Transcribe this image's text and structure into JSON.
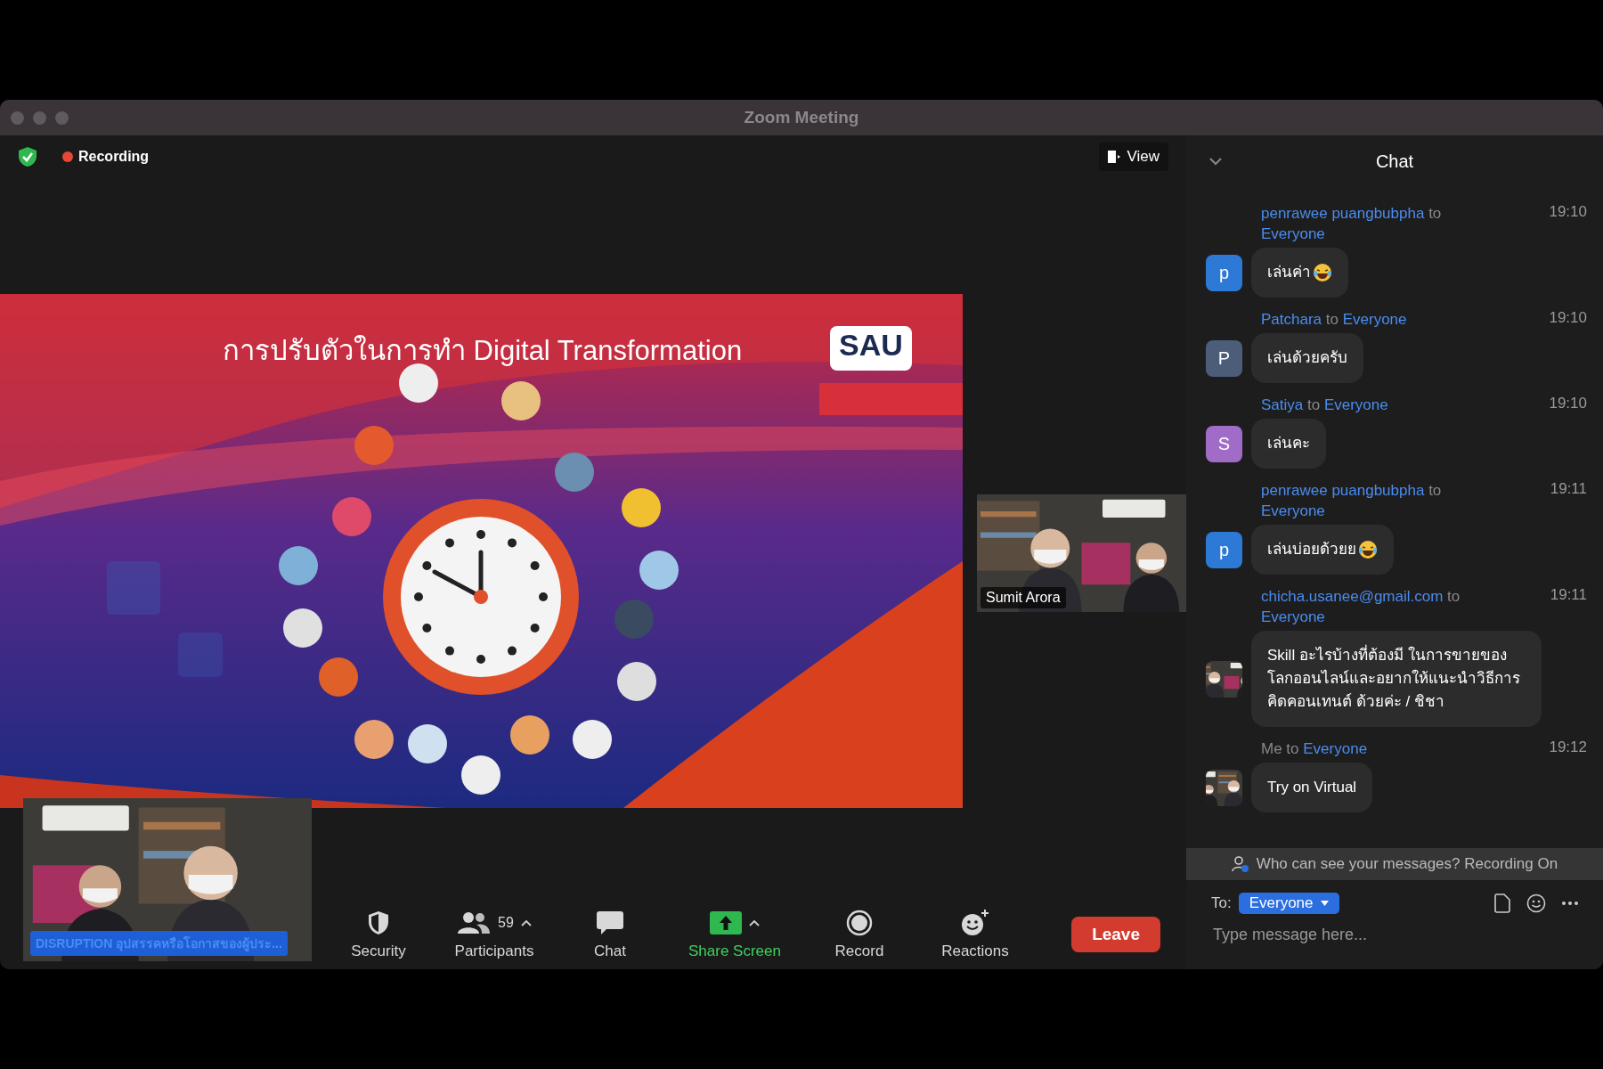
{
  "window": {
    "title": "Zoom Meeting"
  },
  "top_bar": {
    "recording": "Recording",
    "view_button": "View"
  },
  "slide": {
    "title": "การปรับตัวในการทำ Digital Transformation",
    "logo": "SAU"
  },
  "videos": [
    {
      "name": "Sumit Arora",
      "kind": "speaker"
    },
    {
      "name": "DISRUPTION อุปสรรคหรือโอกาสของผู้ประ...",
      "kind": "self"
    }
  ],
  "toolbar": {
    "buttons": [
      {
        "kind": "security",
        "label": "Security",
        "menu": false
      },
      {
        "kind": "participants",
        "label": "Participants",
        "count": "59",
        "menu": true
      },
      {
        "kind": "chat",
        "label": "Chat",
        "menu": false
      },
      {
        "kind": "share",
        "label": "Share Screen",
        "menu": true
      },
      {
        "kind": "record",
        "label": "Record",
        "menu": false
      },
      {
        "kind": "reactions",
        "label": "Reactions",
        "menu": false
      }
    ],
    "leave_button": "Leave"
  },
  "chat": {
    "title": "Chat",
    "messages": [
      {
        "sender": "penrawee puangbubpha",
        "to": "to",
        "recipient": "Everyone",
        "time": "19:10",
        "sender_self": false,
        "avatar": {
          "kind": "letter",
          "letter": "p",
          "color": "#2d7ad6"
        },
        "text": "เล่นค่า",
        "emoji": true
      },
      {
        "sender": "Patchara",
        "to": "to",
        "recipient": "Everyone",
        "time": "19:10",
        "sender_self": false,
        "avatar": {
          "kind": "letter",
          "letter": "P",
          "color": "#4b5d78"
        },
        "text": "เล่นด้วยครับ",
        "emoji": false
      },
      {
        "sender": "Satiya",
        "to": "to",
        "recipient": "Everyone",
        "time": "19:10",
        "sender_self": false,
        "avatar": {
          "kind": "letter",
          "letter": "S",
          "color": "#a06cc8"
        },
        "text": "เล่นคะ",
        "emoji": false
      },
      {
        "sender": "penrawee puangbubpha",
        "to": "to",
        "recipient": "Everyone",
        "time": "19:11",
        "sender_self": false,
        "avatar": {
          "kind": "letter",
          "letter": "p",
          "color": "#2d7ad6"
        },
        "text": "เล่นบ่อยด้วยย",
        "emoji": true
      },
      {
        "sender": "chicha.usanee@gmail.com",
        "to": "to",
        "recipient": "Everyone",
        "time": "19:11",
        "sender_self": false,
        "text": "Skill อะไรบ้างที่ต้องมี ในการขายของโลกออนไลน์และอยากให้แนะนำวิธีการคิดคอนเทนต์ ด้วยค่ะ / ชิชา",
        "emoji": false
      },
      {
        "sender": "Me",
        "to": "to",
        "recipient": "Everyone",
        "time": "19:12",
        "sender_self": true,
        "text": "Try on Virtual",
        "emoji": false
      }
    ],
    "notice": "Who can see your messages? Recording On",
    "to_label": "To:",
    "recipient_button": "Everyone",
    "placeholder": "Type message here..."
  }
}
